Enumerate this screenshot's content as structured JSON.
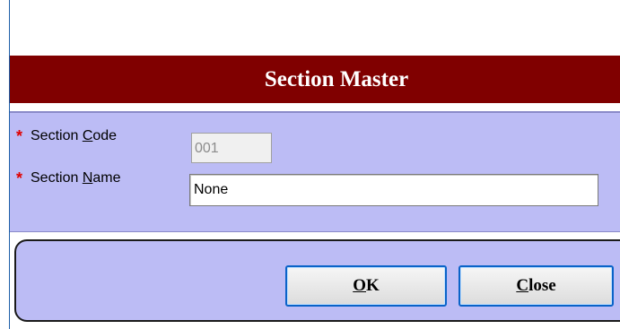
{
  "dialog": {
    "title": "Section Master"
  },
  "fields": {
    "section_code": {
      "label_pre": "Section ",
      "label_key": "C",
      "label_post": "ode",
      "required_marker": "*",
      "value": "001"
    },
    "section_name": {
      "label_pre": "Section ",
      "label_key": "N",
      "label_post": "ame",
      "required_marker": "*",
      "value": "None"
    }
  },
  "buttons": {
    "ok": {
      "key": "O",
      "rest": "K"
    },
    "close": {
      "key": "C",
      "rest": "lose"
    }
  },
  "colors": {
    "title_bar": "#800000",
    "panel": "#bcbcf5",
    "required": "#e00000",
    "button_border": "#0a63c8"
  }
}
